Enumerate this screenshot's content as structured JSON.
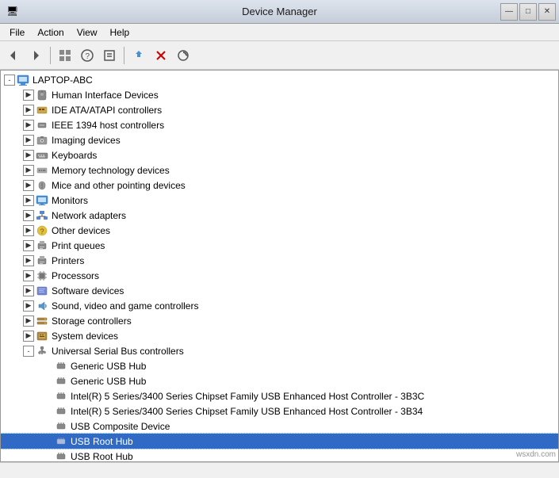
{
  "window": {
    "title": "Device Manager",
    "icon": "🖥"
  },
  "titlebar": {
    "minimize_label": "—",
    "maximize_label": "□",
    "close_label": "✕"
  },
  "menu": {
    "items": [
      {
        "id": "file",
        "label": "File"
      },
      {
        "id": "action",
        "label": "Action"
      },
      {
        "id": "view",
        "label": "View"
      },
      {
        "id": "help",
        "label": "Help"
      }
    ]
  },
  "toolbar": {
    "buttons": [
      {
        "id": "back",
        "icon": "◀",
        "tooltip": "Back"
      },
      {
        "id": "forward",
        "icon": "▶",
        "tooltip": "Forward"
      },
      {
        "id": "up",
        "icon": "⬆",
        "tooltip": "Up"
      },
      {
        "id": "show-hide",
        "icon": "⊞",
        "tooltip": "Show/Hide"
      },
      {
        "id": "properties",
        "icon": "🔧",
        "tooltip": "Properties"
      },
      {
        "id": "update",
        "icon": "⟳",
        "tooltip": "Update"
      },
      {
        "id": "uninstall",
        "icon": "✕",
        "tooltip": "Uninstall"
      },
      {
        "id": "scan",
        "icon": "🔍",
        "tooltip": "Scan"
      }
    ]
  },
  "tree": {
    "root": "LAPTOP-ABC",
    "items": [
      {
        "id": "human-interface",
        "label": "Human Interface Devices",
        "level": 1,
        "expanded": false,
        "icon": "hid"
      },
      {
        "id": "ide-ata",
        "label": "IDE ATA/ATAPI controllers",
        "level": 1,
        "expanded": false,
        "icon": "ide"
      },
      {
        "id": "ieee1394",
        "label": "IEEE 1394 host controllers",
        "level": 1,
        "expanded": false,
        "icon": "1394"
      },
      {
        "id": "imaging",
        "label": "Imaging devices",
        "level": 1,
        "expanded": false,
        "icon": "camera"
      },
      {
        "id": "keyboards",
        "label": "Keyboards",
        "level": 1,
        "expanded": false,
        "icon": "keyboard"
      },
      {
        "id": "memory-tech",
        "label": "Memory technology devices",
        "level": 1,
        "expanded": false,
        "icon": "memory"
      },
      {
        "id": "mice",
        "label": "Mice and other pointing devices",
        "level": 1,
        "expanded": false,
        "icon": "mouse"
      },
      {
        "id": "monitors",
        "label": "Monitors",
        "level": 1,
        "expanded": false,
        "icon": "monitor"
      },
      {
        "id": "network",
        "label": "Network adapters",
        "level": 1,
        "expanded": false,
        "icon": "network"
      },
      {
        "id": "other",
        "label": "Other devices",
        "level": 1,
        "expanded": false,
        "icon": "other"
      },
      {
        "id": "print-queues",
        "label": "Print queues",
        "level": 1,
        "expanded": false,
        "icon": "print"
      },
      {
        "id": "printers",
        "label": "Printers",
        "level": 1,
        "expanded": false,
        "icon": "printer"
      },
      {
        "id": "processors",
        "label": "Processors",
        "level": 1,
        "expanded": false,
        "icon": "cpu"
      },
      {
        "id": "software",
        "label": "Software devices",
        "level": 1,
        "expanded": false,
        "icon": "software"
      },
      {
        "id": "sound",
        "label": "Sound, video and game controllers",
        "level": 1,
        "expanded": false,
        "icon": "sound"
      },
      {
        "id": "storage",
        "label": "Storage controllers",
        "level": 1,
        "expanded": false,
        "icon": "storage"
      },
      {
        "id": "system",
        "label": "System devices",
        "level": 1,
        "expanded": false,
        "icon": "system"
      },
      {
        "id": "usb",
        "label": "Universal Serial Bus controllers",
        "level": 1,
        "expanded": true,
        "icon": "usb"
      },
      {
        "id": "usb-hub-1",
        "label": "Generic USB Hub",
        "level": 2,
        "expanded": false,
        "icon": "hub"
      },
      {
        "id": "usb-hub-2",
        "label": "Generic USB Hub",
        "level": 2,
        "expanded": false,
        "icon": "hub"
      },
      {
        "id": "usb-intel-1",
        "label": "Intel(R) 5 Series/3400 Series Chipset Family USB Enhanced Host Controller - 3B3C",
        "level": 2,
        "expanded": false,
        "icon": "hub"
      },
      {
        "id": "usb-intel-2",
        "label": "Intel(R) 5 Series/3400 Series Chipset Family USB Enhanced Host Controller - 3B34",
        "level": 2,
        "expanded": false,
        "icon": "hub"
      },
      {
        "id": "usb-composite",
        "label": "USB Composite Device",
        "level": 2,
        "expanded": false,
        "icon": "hub"
      },
      {
        "id": "usb-root-1",
        "label": "USB Root Hub",
        "level": 2,
        "expanded": false,
        "icon": "hub",
        "selected": true
      },
      {
        "id": "usb-root-2",
        "label": "USB Root Hub",
        "level": 2,
        "expanded": false,
        "icon": "hub"
      }
    ]
  },
  "statusbar": {
    "text": ""
  },
  "watermark": "wsxdn.com"
}
